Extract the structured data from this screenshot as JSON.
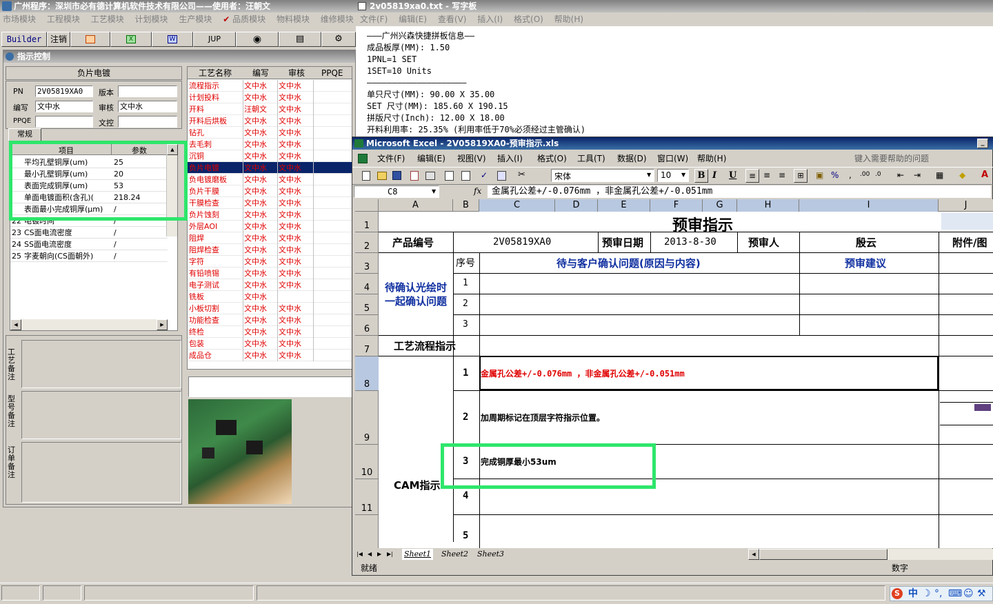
{
  "main_app": {
    "title": "广州程序：深圳市必有德计算机软件技术有限公司——使用者：汪朝文",
    "menu": [
      "市场模块",
      "工程模块",
      "工艺模块",
      "计划模块",
      "生产模块",
      "品质模块",
      "物料模块",
      "维修模块"
    ],
    "toolbar": {
      "builder": "Builder",
      "logout": "注销",
      "jup": "JUP"
    },
    "subwindow_title": "指示控制",
    "process_header": "负片电镀",
    "form": {
      "pn_label": "PN",
      "pn_value": "2V05819XA0",
      "version_label": "版本",
      "version_value": "",
      "author_label": "编写",
      "author_value": "文中水",
      "review_label": "审核",
      "review_value": "文中水",
      "ppqe_label": "PPQE",
      "ppqe_value": "",
      "proofread_label": "文控",
      "proofread_value": ""
    },
    "tab_general": "常规",
    "params_grid": {
      "headers": [
        "项目",
        "参数"
      ],
      "rows": [
        {
          "no": "",
          "item": "平均孔壁铜厚(um)",
          "value": "25"
        },
        {
          "no": "",
          "item": "最小孔壁铜厚(um)",
          "value": "20"
        },
        {
          "no": "",
          "item": "表面完成铜厚(um)",
          "value": "53"
        },
        {
          "no": "",
          "item": "单面电镀面积(含孔)(",
          "value": "218.24"
        },
        {
          "no": "",
          "item": "表面最小完成铜厚(μm)",
          "value": "/"
        },
        {
          "no": "22",
          "item": "电镀时间",
          "value": "/"
        },
        {
          "no": "23",
          "item": "CS面电流密度",
          "value": "/"
        },
        {
          "no": "24",
          "item": "SS面电流密度",
          "value": "/"
        },
        {
          "no": "25",
          "item": "字麦朝向(CS面朝外)",
          "value": "/"
        }
      ]
    },
    "note_labels": [
      "工艺备注",
      "型号备注",
      "订单备注"
    ],
    "process_grid": {
      "headers": [
        "工艺名称",
        "编写",
        "审核",
        "PPQE"
      ],
      "rows": [
        {
          "name": "流程指示",
          "author": "文中水",
          "review": "文中水"
        },
        {
          "name": "计划投料",
          "author": "文中水",
          "review": "文中水"
        },
        {
          "name": "开料",
          "author": "汪朝文",
          "review": "文中水"
        },
        {
          "name": "开料后烘板",
          "author": "文中水",
          "review": "文中水"
        },
        {
          "name": "钻孔",
          "author": "文中水",
          "review": "文中水"
        },
        {
          "name": "去毛刺",
          "author": "文中水",
          "review": "文中水"
        },
        {
          "name": "沉铜",
          "author": "文中水",
          "review": "文中水"
        },
        {
          "name": "负片电镀",
          "author": "文中水",
          "review": "文中水"
        },
        {
          "name": "负电镀磨板",
          "author": "文中水",
          "review": "文中水"
        },
        {
          "name": "负片干膜",
          "author": "文中水",
          "review": "文中水"
        },
        {
          "name": "干膜检查",
          "author": "文中水",
          "review": "文中水"
        },
        {
          "name": "负片蚀刻",
          "author": "文中水",
          "review": "文中水"
        },
        {
          "name": "外层AOI",
          "author": "文中水",
          "review": "文中水"
        },
        {
          "name": "阻焊",
          "author": "文中水",
          "review": "文中水"
        },
        {
          "name": "阻焊检查",
          "author": "文中水",
          "review": "文中水"
        },
        {
          "name": "字符",
          "author": "文中水",
          "review": "文中水"
        },
        {
          "name": "有铅喷锡",
          "author": "文中水",
          "review": "文中水"
        },
        {
          "name": "电子测试",
          "author": "文中水",
          "review": "文中水"
        },
        {
          "name": "铣板",
          "author": "文中水",
          "review": ""
        },
        {
          "name": "小板切割",
          "author": "文中水",
          "review": "文中水"
        },
        {
          "name": "功能检查",
          "author": "文中水",
          "review": "文中水"
        },
        {
          "name": "终检",
          "author": "文中水",
          "review": "文中水"
        },
        {
          "name": "包装",
          "author": "文中水",
          "review": "文中水"
        },
        {
          "name": "成品仓",
          "author": "文中水",
          "review": "文中水"
        }
      ]
    }
  },
  "notepad": {
    "title": "2v05819xa0.txt - 写字板",
    "menu": [
      "文件(F)",
      "编辑(E)",
      "查看(V)",
      "插入(I)",
      "格式(O)",
      "帮助(H)"
    ],
    "lines": [
      "———广州兴森快捷拼板信息——",
      "成品板厚(MM): 1.50",
      "1PNL=1 SET",
      "1SET=10 Units",
      "————————————————————",
      "单只尺寸(MM): 90.00 X 35.00",
      "SET 尺寸(MM): 185.60 X 190.15",
      "拼版尺寸(Inch): 12.00 X 18.00",
      "开料利用率: 25.35% (利用率低于70%必须经过主管确认)"
    ]
  },
  "excel": {
    "title": "Microsoft Excel - 2V05819XA0-预审指示.xls",
    "menu": [
      "文件(F)",
      "编辑(E)",
      "视图(V)",
      "插入(I)",
      "格式(O)",
      "工具(T)",
      "数据(D)",
      "窗口(W)",
      "帮助(H)"
    ],
    "help_placeholder": "键入需要帮助的问题",
    "font_name": "宋体",
    "font_size": "10",
    "name_box": "C8",
    "fx": "fx",
    "formula": "金属孔公差+/-0.076mm ，非金属孔公差+/-0.051mm",
    "columns": [
      "A",
      "B",
      "C",
      "D",
      "E",
      "F",
      "G",
      "H",
      "I",
      "J"
    ],
    "row_numbers": [
      "1",
      "2",
      "3",
      "4",
      "5",
      "6",
      "7",
      "8",
      "9",
      "10",
      "11"
    ],
    "sheet": {
      "title": "预审指示",
      "product_no_label": "产品编号",
      "product_no": "2V05819XA0",
      "review_date_label": "预审日期",
      "review_date": "2013-8-30",
      "reviewer_label": "预审人",
      "reviewer": "殷云",
      "attachment_label": "附件/图",
      "seq_label": "序号",
      "issue_header": "待与客户确认问题(原因与内容)",
      "suggest_header": "预审建议",
      "confirm_label": "待确认光绘时一起确认问题",
      "confirm_seq": [
        "1",
        "2",
        "3"
      ],
      "flow_label": "工艺流程指示",
      "cam_label": "CAM指示",
      "cam_items": [
        {
          "seq": "1",
          "text": "金属孔公差+/-0.076mm ，非金属孔公差+/-0.051mm"
        },
        {
          "seq": "2",
          "text": "加周期标记在顶层字符指示位置。"
        },
        {
          "seq": "3",
          "text": "完成铜厚最小53um"
        },
        {
          "seq": "4",
          "text": ""
        },
        {
          "seq": "5",
          "text": ""
        }
      ]
    },
    "sheet_tabs": [
      "Sheet1",
      "Sheet2",
      "Sheet3"
    ],
    "status_ready": "就绪",
    "status_num": "数字"
  },
  "taskbar": {
    "ime": [
      "中"
    ]
  }
}
